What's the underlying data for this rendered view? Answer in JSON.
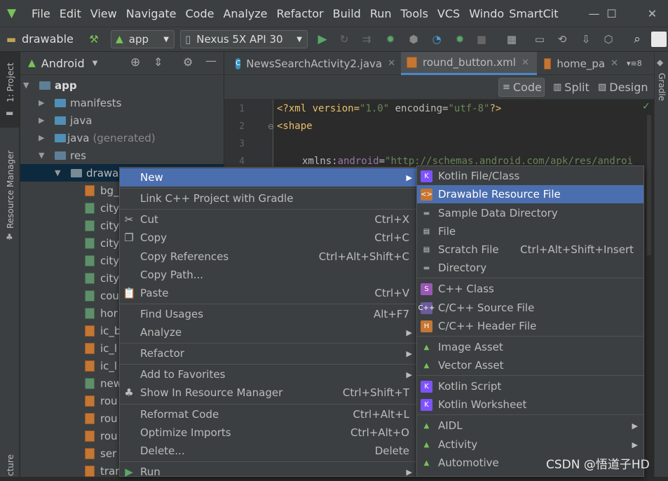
{
  "menubar": {
    "items": [
      "File",
      "Edit",
      "View",
      "Navigate",
      "Code",
      "Analyze",
      "Refactor",
      "Build",
      "Run",
      "Tools",
      "VCS",
      "Windo"
    ],
    "app_name": "SmartCit"
  },
  "toolbar": {
    "breadcrumb": "drawable",
    "run_config": "app",
    "device": "Nexus 5X API 30"
  },
  "left_strip": {
    "project": "1: Project",
    "resource_manager": "Resource Manager",
    "structure": "cture"
  },
  "right_strip": {
    "gradle": "Gradle"
  },
  "project_panel": {
    "view_mode": "Android",
    "tree": [
      {
        "label": "app",
        "extra": ""
      },
      {
        "label": "manifests",
        "extra": ""
      },
      {
        "label": "java",
        "extra": ""
      },
      {
        "label": "java",
        "extra": "(generated)"
      },
      {
        "label": "res",
        "extra": ""
      },
      {
        "label": "drawal",
        "extra": ""
      }
    ],
    "files": [
      "bg_",
      "city",
      "city",
      "city",
      "city",
      "city",
      "cou",
      "hor",
      "ic_b",
      "ic_l",
      "ic_l",
      "new",
      "rou",
      "rou",
      "rou",
      "ser",
      "trar"
    ]
  },
  "tabs": [
    {
      "label": "NewsSearchActivity2.java"
    },
    {
      "label": "round_button.xml"
    },
    {
      "label": "home_pa"
    }
  ],
  "tab_overflow": "8",
  "view_modes": {
    "code": "Code",
    "split": "Split",
    "design": "Design"
  },
  "editor": {
    "line_numbers": [
      "1",
      "2",
      "3",
      "4"
    ],
    "line1": {
      "a": "<?xml version=",
      "b": "\"1.0\"",
      "c": " encoding=",
      "d": "\"utf-8\"",
      "e": "?>"
    },
    "line2": "<shape",
    "line4": {
      "a": "xmlns:",
      "b": "android",
      "c": "=",
      "d": "\"http://schemas.android.com/apk/res/androi"
    }
  },
  "context_menu": {
    "items": [
      {
        "label": "New",
        "shortcut": "",
        "submenu": true
      },
      {
        "label": "Link C++ Project with Gradle",
        "shortcut": ""
      },
      {
        "label": "Cut",
        "shortcut": "Ctrl+X"
      },
      {
        "label": "Copy",
        "shortcut": "Ctrl+C"
      },
      {
        "label": "Copy References",
        "shortcut": "Ctrl+Alt+Shift+C"
      },
      {
        "label": "Copy Path...",
        "shortcut": ""
      },
      {
        "label": "Paste",
        "shortcut": "Ctrl+V"
      },
      {
        "label": "Find Usages",
        "shortcut": "Alt+F7"
      },
      {
        "label": "Analyze",
        "shortcut": "",
        "submenu": true
      },
      {
        "label": "Refactor",
        "shortcut": "",
        "submenu": true
      },
      {
        "label": "Add to Favorites",
        "shortcut": "",
        "submenu": true
      },
      {
        "label": "Show In Resource Manager",
        "shortcut": "Ctrl+Shift+T"
      },
      {
        "label": "Reformat Code",
        "shortcut": "Ctrl+Alt+L"
      },
      {
        "label": "Optimize Imports",
        "shortcut": "Ctrl+Alt+O"
      },
      {
        "label": "Delete...",
        "shortcut": "Delete"
      },
      {
        "label": "Run",
        "shortcut": "",
        "submenu": true
      }
    ]
  },
  "new_submenu": {
    "items": [
      {
        "label": "Kotlin File/Class",
        "shortcut": ""
      },
      {
        "label": "Drawable Resource File",
        "shortcut": ""
      },
      {
        "label": "Sample Data Directory",
        "shortcut": ""
      },
      {
        "label": "File",
        "shortcut": ""
      },
      {
        "label": "Scratch File",
        "shortcut": "Ctrl+Alt+Shift+Insert"
      },
      {
        "label": "Directory",
        "shortcut": ""
      },
      {
        "label": "C++ Class",
        "shortcut": ""
      },
      {
        "label": "C/C++ Source File",
        "shortcut": ""
      },
      {
        "label": "C/C++ Header File",
        "shortcut": ""
      },
      {
        "label": "Image Asset",
        "shortcut": ""
      },
      {
        "label": "Vector Asset",
        "shortcut": ""
      },
      {
        "label": "Kotlin Script",
        "shortcut": ""
      },
      {
        "label": "Kotlin Worksheet",
        "shortcut": ""
      },
      {
        "label": "AIDL",
        "shortcut": ""
      },
      {
        "label": "Activity",
        "shortcut": ""
      },
      {
        "label": "Automotive",
        "shortcut": ""
      }
    ]
  },
  "watermark": "CSDN @悟道子HD",
  "colors": {
    "selection": "#4b6eaf",
    "android_green": "#78c257",
    "keyword": "#e8bf6a",
    "string": "#6a8759"
  }
}
